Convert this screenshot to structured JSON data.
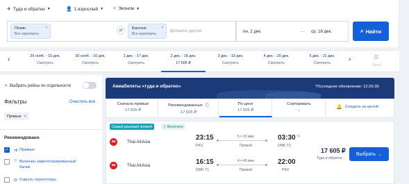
{
  "search": {
    "trip_type": "Туда и обратно",
    "passengers": "1 взрослый",
    "cabin": "Эконом",
    "from_city": "Пекин",
    "from_sub": "Все аэропорты",
    "to_city": "Бангкок",
    "to_sub": "Все аэропорты",
    "add_another": "Добавить другой",
    "date_from": "пн, 2 дек.",
    "date_to": "ср, 18 дек.",
    "search_label": "Найти"
  },
  "date_strip": [
    {
      "range": "29 нояб. - 15 дек.",
      "price": "Смотреть"
    },
    {
      "range": "30 нояб. - 16 дек.",
      "price": "Смотреть"
    },
    {
      "range": "1 дек. - 17 дек.",
      "price": "Смотреть"
    },
    {
      "range": "2 дек. - 18 дек.",
      "price": "17 605 ₽"
    },
    {
      "range": "3 дек. - 19 дек.",
      "price": "Смотреть"
    },
    {
      "range": "4 дек. - 20 дек.",
      "price": "Смотреть"
    },
    {
      "range": "5 дек. - 21 дек.",
      "price": "Смотреть"
    }
  ],
  "date_strip_chart_label": "Цена",
  "sidebar": {
    "separate_label": "Выбрать рейсы по отдельности",
    "filters_title": "Фильтры",
    "clear_all": "Очистить все",
    "active_filter": "Прямые",
    "recommended_title": "Рекомендовано",
    "options": [
      {
        "label": "Прямые",
        "checked": true
      },
      {
        "label": "Включен зарегистрированный багаж",
        "checked": false
      },
      {
        "label": "Скрыть лоукостеры",
        "checked": false
      }
    ]
  },
  "banner": {
    "title": "Авиабилеты «туда и обратно»",
    "updated": "*Последнее обновление: 12:26:39"
  },
  "sort_tabs": [
    {
      "label": "Сначала прямые",
      "price": "17 605 ₽"
    },
    {
      "label": "Рекомендованные",
      "price": "17 605 ₽"
    },
    {
      "label": "По цене",
      "price": "17 605 ₽"
    },
    {
      "label": "Сортировать",
      "price": ""
    }
  ],
  "track_price": "Следить за ценой",
  "result": {
    "badge_best": "Самый дешевый прямой",
    "badge_included": "Включено",
    "legs": [
      {
        "airline": "Thai AirAsia",
        "dep_time": "23:15",
        "dep_code": "PKX",
        "duration": "5 ч 15 мин",
        "stops": "Прямой",
        "arr_time": "03:30",
        "arr_plus": "+1",
        "arr_code": "DMK T1"
      },
      {
        "airline": "Thai AirAsia",
        "dep_time": "16:15",
        "dep_code": "DMK T1",
        "duration": "4 ч 45 мин",
        "stops": "Прямой",
        "arr_time": "22:00",
        "arr_plus": "",
        "arr_code": "PKX"
      }
    ],
    "price": "17 605 ₽",
    "price_sub": "Туда и обратно",
    "select_label": "Выбрать"
  },
  "colors": {
    "accent": "#1560d8",
    "banner": "#1d3a78",
    "airline_logo": "#e02020"
  }
}
